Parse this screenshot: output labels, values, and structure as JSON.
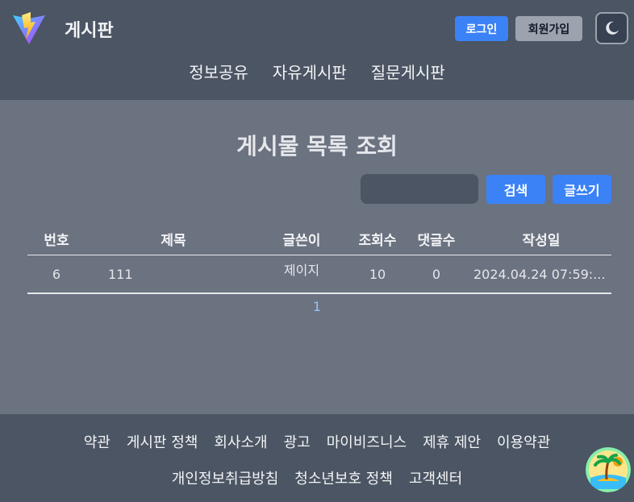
{
  "header": {
    "site_title": "게시판",
    "login_label": "로그인",
    "signup_label": "회원가입",
    "nav": [
      "정보공유",
      "자유게시판",
      "질문게시판"
    ]
  },
  "main": {
    "title": "게시물 목록 조회",
    "search_placeholder": "",
    "search_label": "검색",
    "write_label": "글쓰기",
    "columns": [
      "번호",
      "제목",
      "글쓴이",
      "조회수",
      "댓글수",
      "작성일"
    ],
    "rows": [
      {
        "num": "6",
        "title": "111",
        "writer": "제이지",
        "views": "10",
        "comments": "0",
        "date": "2024.04.24 07:59:..."
      }
    ],
    "page": "1"
  },
  "footer": {
    "row1": [
      "약관",
      "게시판 정책",
      "회사소개",
      "광고",
      "마이비즈니스",
      "제휴 제안",
      "이용약관"
    ],
    "row2": [
      "개인정보취급방침",
      "청소년보호 정책",
      "고객센터"
    ]
  },
  "colors": {
    "header_bg": "#4b5563",
    "body_bg": "#6b7280",
    "accent": "#3b82f6"
  },
  "icons": {
    "logo": "vite-logo-icon",
    "theme": "moon-icon",
    "badge": "beach-island-icon"
  }
}
